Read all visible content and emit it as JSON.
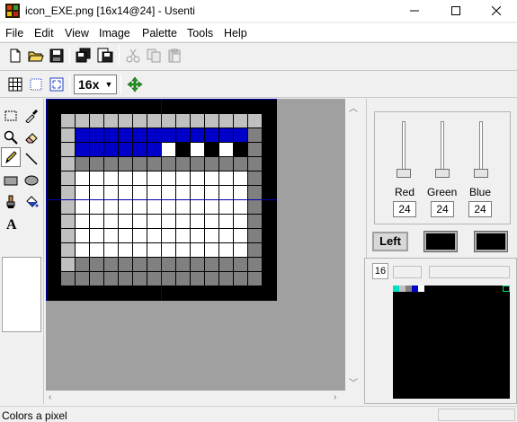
{
  "window": {
    "title": "icon_EXE.png [16x14@24] - Usenti",
    "minimize_icon": "minimize-icon",
    "maximize_icon": "maximize-icon",
    "close_icon": "close-icon"
  },
  "menu": [
    "File",
    "Edit",
    "View",
    "Image",
    "Palette",
    "Tools",
    "Help"
  ],
  "toolbar": {
    "zoom_value": "16x",
    "icons": [
      "new-file-icon",
      "open-folder-icon",
      "save-icon",
      "save-all-icon",
      "export-icon",
      "cut-icon",
      "copy-icon",
      "paste-icon",
      "grid-icon",
      "select-icon",
      "fit-icon",
      "move-icon"
    ]
  },
  "tools": [
    "rectangle-select-icon",
    "eyedropper-icon",
    "zoom-icon",
    "eraser-icon",
    "pencil-icon",
    "line-icon",
    "rectangle-icon",
    "ellipse-icon",
    "brush-icon",
    "fill-bucket-icon",
    "text-tool-icon"
  ],
  "colors": {
    "black": "#000000",
    "white": "#ffffff",
    "light_gray": "#c0c0c0",
    "gray": "#808080",
    "blue": "#0000c8",
    "canvas_bg": "#a0a0a0"
  },
  "image": {
    "width": 16,
    "height": 14,
    "rows": [
      "KKKKKKKKKKKKKKKK",
      "KLLLLLLLLLLLLLLK",
      "KLBBBBBBBBBBBBGK",
      "KLBBBBBBWKWKWKGK",
      "KLGGGGGGGGGGGGGK",
      "KLWWWWWWWWWWWWGK",
      "KLWWWWWWWWWWWWGK",
      "KLWWWWWWWWWWWWGK",
      "KLWWWWWWWWWWWWGK",
      "KLWWWWWWWWWWWWGK",
      "KLWWWWWWWWWWWWGK",
      "KLGGGGGGGGGGGGGK",
      "KGGGGGGGGGGGGGGK",
      "KKKKKKKKKKKKKKKK"
    ]
  },
  "color_panel": {
    "red_label": "Red",
    "green_label": "Green",
    "blue_label": "Blue",
    "red_value": "24",
    "green_value": "24",
    "blue_value": "24",
    "left_button": "Left"
  },
  "palette": {
    "count_label": "16",
    "entries": [
      "#00e0c0",
      "#c0c0c0",
      "#808080",
      "#0000c8",
      "#ffffff"
    ]
  },
  "status": {
    "text": "Colors a pixel"
  }
}
